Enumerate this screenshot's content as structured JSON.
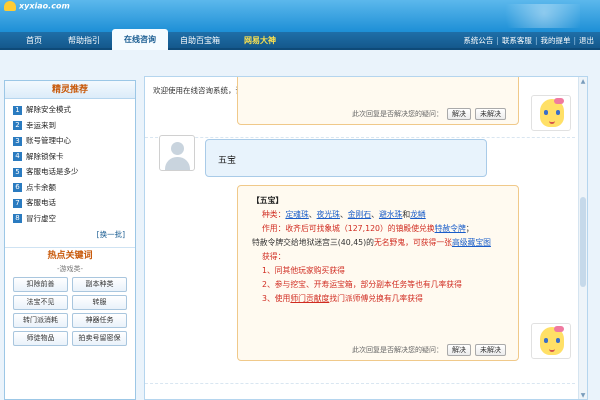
{
  "header": {
    "logo_text": "xyxiao.com"
  },
  "nav": {
    "items": [
      {
        "label": "首页"
      },
      {
        "label": "帮助指引"
      },
      {
        "label": "在线咨询"
      },
      {
        "label": "自助百宝箱"
      },
      {
        "label": "网易大神"
      }
    ],
    "right_links": [
      "系统公告",
      "联系客服",
      "我的提单",
      "退出"
    ]
  },
  "sidebar": {
    "title": "精灵推荐",
    "items": [
      {
        "num": "1",
        "label": "解除安全模式"
      },
      {
        "num": "2",
        "label": "幸运来到"
      },
      {
        "num": "3",
        "label": "账号管理中心"
      },
      {
        "num": "4",
        "label": "解除锁保卡"
      },
      {
        "num": "5",
        "label": "客服电话是多少"
      },
      {
        "num": "6",
        "label": "点卡余额"
      },
      {
        "num": "7",
        "label": "客服电话"
      },
      {
        "num": "8",
        "label": "冒行虚空"
      }
    ],
    "more": "[换一批]",
    "keywords_title": "热点关键词",
    "keywords_sub": "-游戏类-",
    "keywords": [
      "扣除前善",
      "副本种类",
      "法宝不见",
      "转服",
      "转门派消耗",
      "神器任务",
      "师徒物品",
      "拍卖号留密保"
    ]
  },
  "chat": {
    "welcome": "欢迎使用在线咨询系统，请您在下方输入提问内容。",
    "feedback_q": "此次回复是否解决您的疑问：",
    "solved": "解决",
    "unsolved": "未解决",
    "user_message": "五宝",
    "answer": {
      "title": "【五宝】",
      "types_label": "种类：",
      "types": [
        "定魂珠",
        "夜光珠",
        "金刚石",
        "避水珠",
        "龙鳞"
      ],
      "types_and": "和",
      "usage_1": "作用：收齐后可找象城（127,120）的镇殿使兑换",
      "usage_item": "特赦令牌",
      "usage_2": "；",
      "usage_3": "特赦令牌交给地狱迷宫三(40,45)的",
      "usage_npc": "无名野鬼",
      "usage_4": "，可获得一张",
      "usage_link": "高级藏宝图",
      "obtain_label": "获得：",
      "obtain_1": "1、同其他玩家购买获得",
      "obtain_2": "2、参与挖宝、开寿运宝箱，部分副本任务等也有几率获得",
      "obtain_3_a": "3、使用",
      "obtain_3_link": "师门贡献度",
      "obtain_3_b": "找门派师傅兑换有几率获得"
    }
  }
}
